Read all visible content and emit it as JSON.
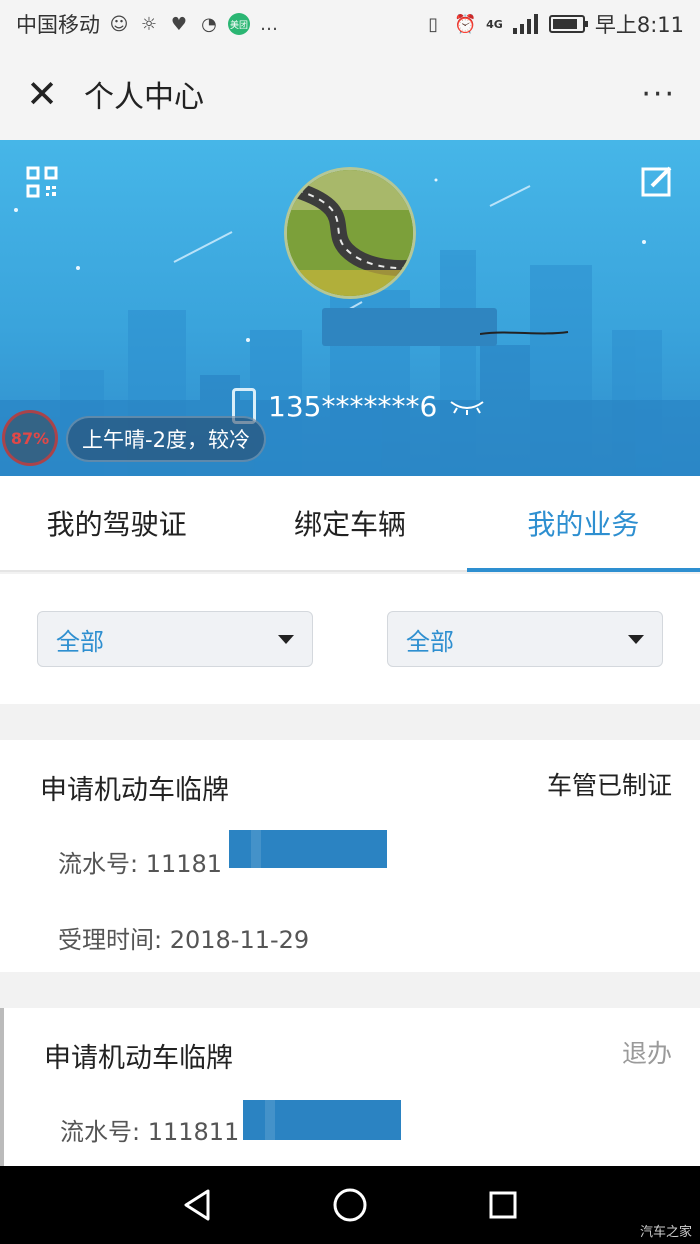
{
  "status_bar": {
    "carrier": "中国移动",
    "network": "4G",
    "time": "早上8:11",
    "badge_text": "美团"
  },
  "title_bar": {
    "close_icon": "close-icon",
    "title": "个人中心",
    "more_label": "···"
  },
  "profile": {
    "phone": "135*******6",
    "battery_percent_label": "87%",
    "weather": "上午晴-2度，较冷"
  },
  "tabs": [
    {
      "label": "我的驾驶证",
      "active": false
    },
    {
      "label": "绑定车辆",
      "active": false
    },
    {
      "label": "我的业务",
      "active": true
    }
  ],
  "filters": {
    "left_selected": "全部",
    "right_selected": "全部"
  },
  "records": [
    {
      "title": "申请机动车临牌",
      "status": "车管已制证",
      "serial_label": "流水号: 11181",
      "accept_time_label": "受理时间: 2018-11-29"
    },
    {
      "title": "申请机动车临牌",
      "status": "退办",
      "serial_label": "流水号: 111811"
    }
  ],
  "watermark": "汽车之家",
  "colors": {
    "accent": "#2e8fd0",
    "banner_top": "#46b6e8",
    "status_done": "#222222",
    "status_returned": "#9a9a9a"
  }
}
